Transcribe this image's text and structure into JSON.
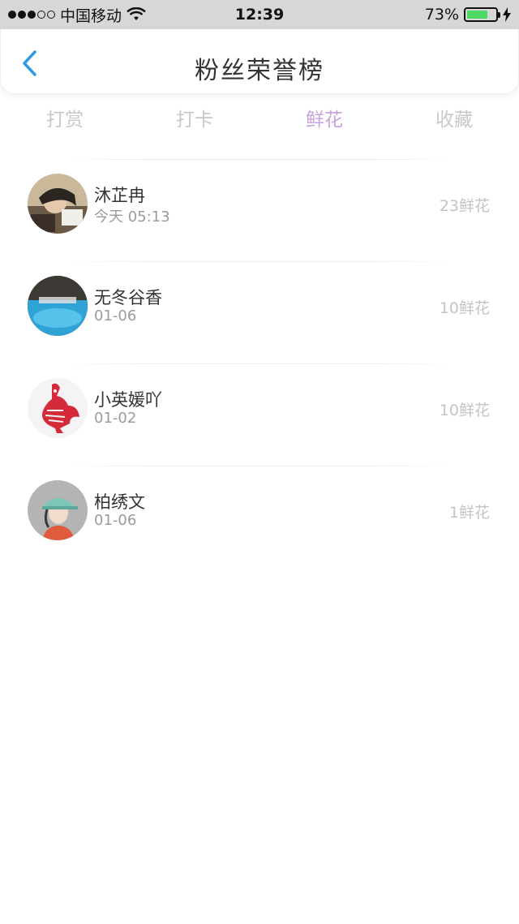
{
  "status_bar": {
    "carrier": "中国移动",
    "time": "12:39",
    "battery": "73%",
    "battery_level": 0.73
  },
  "nav": {
    "title": "粉丝荣誉榜"
  },
  "tabs": [
    {
      "label": "打赏",
      "active": false
    },
    {
      "label": "打卡",
      "active": false
    },
    {
      "label": "鲜花",
      "active": true
    },
    {
      "label": "收藏",
      "active": false
    }
  ],
  "fans": [
    {
      "name": "沐芷冉",
      "time": "今天 05:13",
      "count": "23鲜花"
    },
    {
      "name": "无冬谷香",
      "time": "01-06",
      "count": "10鲜花"
    },
    {
      "name": "小英媛吖",
      "time": "01-02",
      "count": "10鲜花"
    },
    {
      "name": "柏绣文",
      "time": "01-06",
      "count": "1鲜花"
    }
  ],
  "colors": {
    "accent_tab": "#c9a1db",
    "back_arrow": "#2f9be3",
    "battery_fill": "#4cd964"
  }
}
